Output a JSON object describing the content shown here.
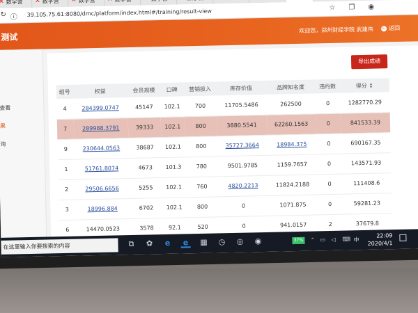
{
  "browser": {
    "tab_title": "数字营",
    "active_tab_title": "数",
    "tab_count_visible": 9,
    "url": "39.105.75.61:8080/dmc/platform/index.html#/training/result-view",
    "icons": {
      "tab": "arrow-logo-icon",
      "back": "back-arrow-icon",
      "refresh": "refresh-icon",
      "info": "info-icon",
      "star": "star-icon",
      "collections": "collections-icon",
      "profile": "profile-icon",
      "new_tab": "plus-icon",
      "tab_list": "chevron-down-icon"
    }
  },
  "header": {
    "title": "测试",
    "user_text": "欢迎您，郑州财经学院 武建伟",
    "back_label": "返回",
    "color": "#e2561a"
  },
  "sidebar": {
    "items": [
      {
        "label": "查看"
      },
      {
        "label": "果"
      },
      {
        "label": "询"
      }
    ]
  },
  "toolbar": {
    "export_label": "导出成绩",
    "export_color": "#c9261b"
  },
  "table": {
    "columns": [
      "组号",
      "权益",
      "会员规模",
      "口碑",
      "营销投入",
      "库存价值",
      "品牌知名度",
      "违约数",
      "得分 ↕"
    ],
    "rows": [
      {
        "cells": [
          "4",
          "284399.0747",
          "45147",
          "102.1",
          "700",
          "11705.5486",
          "262500",
          "0",
          "1282770.29"
        ],
        "links": [
          1
        ]
      },
      {
        "cells": [
          "7",
          "289988.3791",
          "39333",
          "102.1",
          "800",
          "3880.5541",
          "62260.1563",
          "0",
          "841533.39"
        ],
        "links": [
          1
        ],
        "highlight": true
      },
      {
        "cells": [
          "9",
          "230644.0563",
          "38687",
          "102.1",
          "800",
          "35727.3664",
          "18984.375",
          "0",
          "690167.35"
        ],
        "links": [
          1,
          5,
          6
        ]
      },
      {
        "cells": [
          "1",
          "51761.8074",
          "4673",
          "101.3",
          "780",
          "9501.9785",
          "1159.7657",
          "0",
          "143571.93"
        ],
        "links": [
          1
        ]
      },
      {
        "cells": [
          "2",
          "29506.6656",
          "5255",
          "102.1",
          "760",
          "4820.2213",
          "11824.2188",
          "0",
          "111408.6"
        ],
        "links": [
          1,
          5
        ]
      },
      {
        "cells": [
          "3",
          "18996.884",
          "6702",
          "102.1",
          "800",
          "0",
          "1071.875",
          "0",
          "59281.23"
        ],
        "links": [
          1
        ]
      },
      {
        "cells": [
          "6",
          "14470.0523",
          "3578",
          "92.1",
          "520",
          "0",
          "941.0157",
          "2",
          "37679.8"
        ],
        "links": []
      }
    ]
  },
  "taskbar": {
    "search_placeholder": "在这里输入你要搜索的内容",
    "battery": "37%",
    "clock_time": "22:09",
    "clock_date": "2020/4/1",
    "icons": [
      "task-view-icon",
      "pinwheel-icon",
      "ie-icon",
      "edge-icon",
      "calculator-icon",
      "clock-icon",
      "360-icon",
      "chrome-icon"
    ]
  }
}
